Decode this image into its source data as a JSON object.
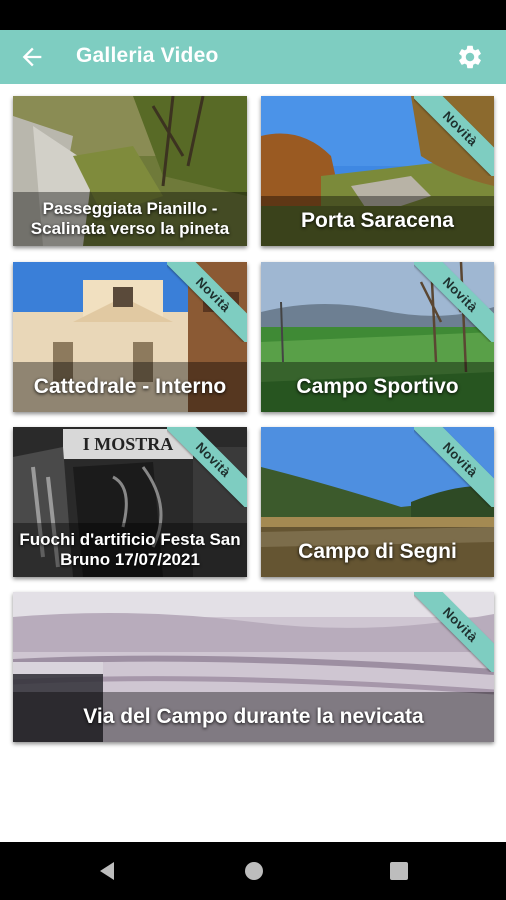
{
  "app_bar": {
    "title": "Galleria Video",
    "background": "#7ecdc1",
    "back_icon": "arrow-left-icon",
    "settings_icon": "gear-icon"
  },
  "badge_label": "Novità",
  "videos": [
    {
      "caption": "Passeggiata Pianillo - Scalinata verso la pineta",
      "new": false
    },
    {
      "caption": "Porta Saracena",
      "new": true
    },
    {
      "caption": "Cattedrale - Interno",
      "new": true
    },
    {
      "caption": "Campo Sportivo",
      "new": true
    },
    {
      "caption": "Fuochi d'artificio Festa San Bruno 17/07/2021",
      "new": true,
      "sign_text": "I MOSTRA"
    },
    {
      "caption": "Campo di Segni",
      "new": true
    },
    {
      "caption": "Via del Campo durante la nevicata",
      "new": true
    }
  ],
  "nav_bar": {
    "back_icon": "triangle-back-icon",
    "home_icon": "circle-home-icon",
    "recents_icon": "square-recents-icon"
  }
}
